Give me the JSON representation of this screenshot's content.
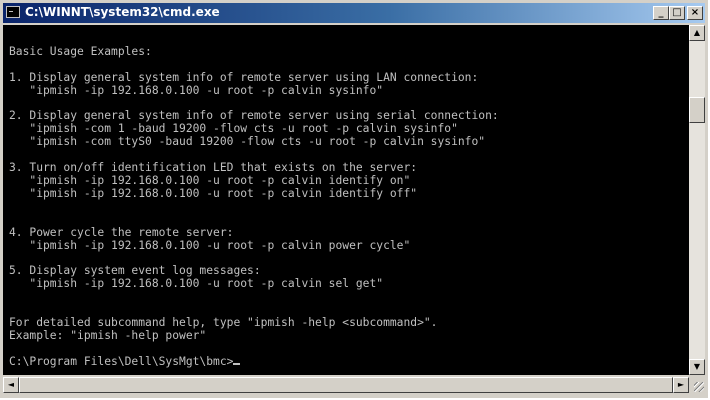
{
  "window": {
    "title": "C:\\WINNT\\system32\\cmd.exe",
    "buttons": {
      "minimize": "_",
      "maximize": "□",
      "close": "×"
    }
  },
  "console": {
    "lines": [
      "",
      "Basic Usage Examples:",
      "",
      "1. Display general system info of remote server using LAN connection:",
      "   \"ipmish -ip 192.168.0.100 -u root -p calvin sysinfo\"",
      "",
      "2. Display general system info of remote server using serial connection:",
      "   \"ipmish -com 1 -baud 19200 -flow cts -u root -p calvin sysinfo\"",
      "   \"ipmish -com ttyS0 -baud 19200 -flow cts -u root -p calvin sysinfo\"",
      "",
      "3. Turn on/off identification LED that exists on the server:",
      "   \"ipmish -ip 192.168.0.100 -u root -p calvin identify on\"",
      "   \"ipmish -ip 192.168.0.100 -u root -p calvin identify off\"",
      "",
      "",
      "4. Power cycle the remote server:",
      "   \"ipmish -ip 192.168.0.100 -u root -p calvin power cycle\"",
      "",
      "5. Display system event log messages:",
      "   \"ipmish -ip 192.168.0.100 -u root -p calvin sel get\"",
      "",
      "",
      "For detailed subcommand help, type \"ipmish -help <subcommand>\".",
      "Example: \"ipmish -help power\"",
      "",
      "C:\\Program Files\\Dell\\SysMgt\\bmc>"
    ]
  },
  "scrollbars": {
    "vertical": {
      "up": "▲",
      "down": "▼"
    },
    "horizontal": {
      "left": "◄",
      "right": "►"
    }
  }
}
